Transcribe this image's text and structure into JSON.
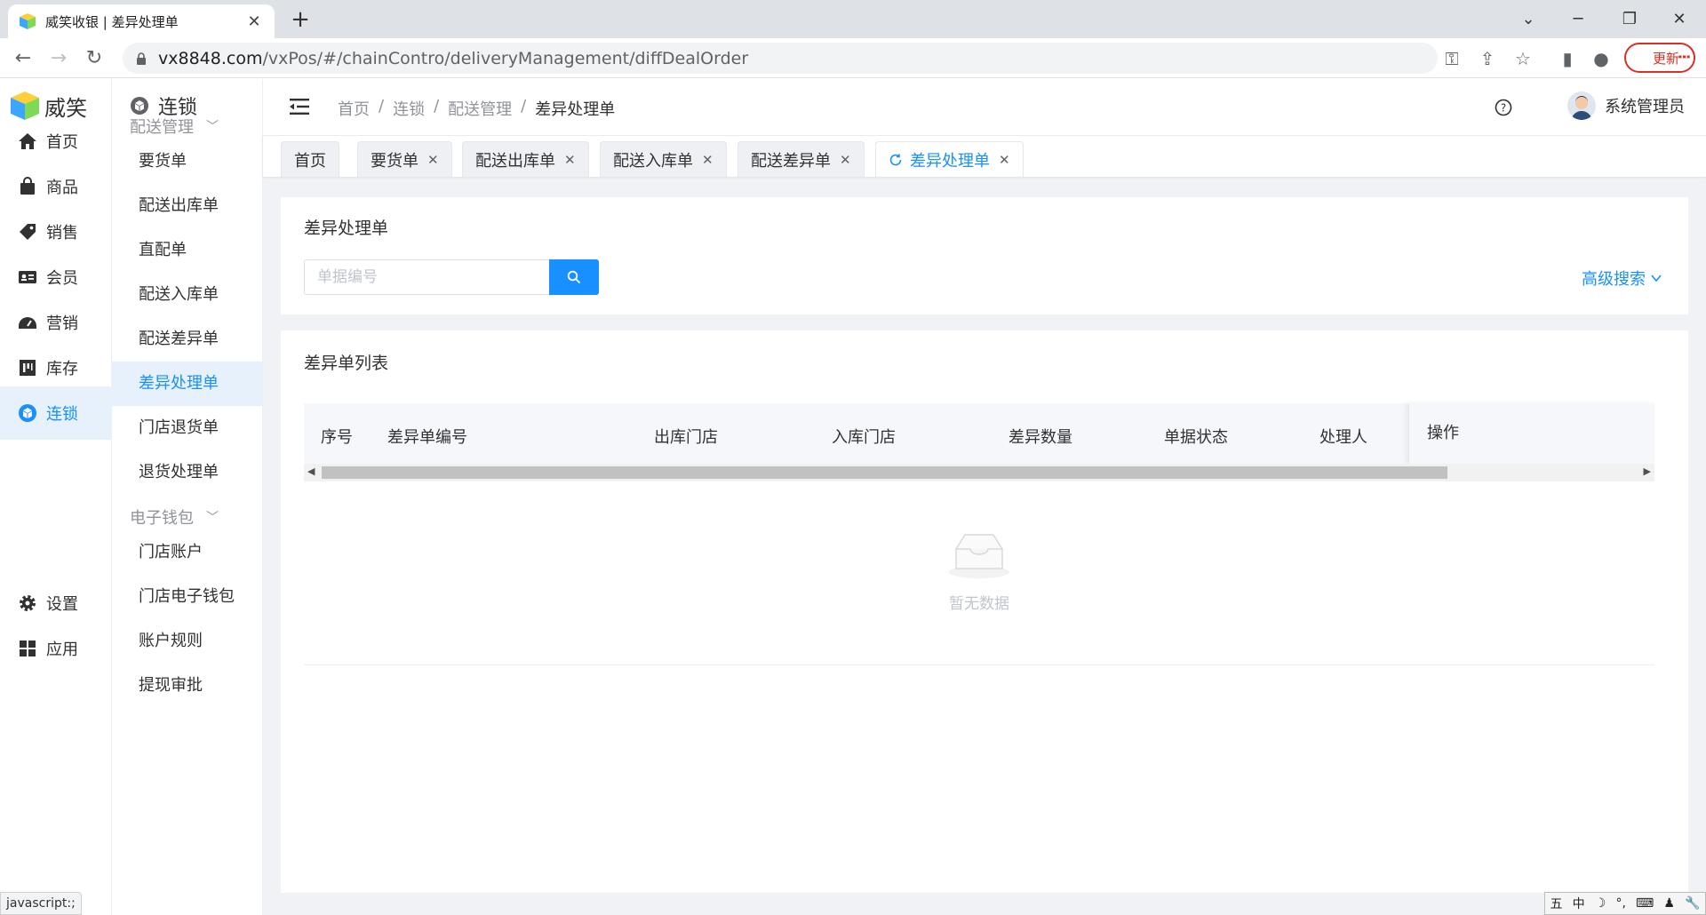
{
  "browser": {
    "tab_title": "威笑收银 | 差异处理单",
    "url_host": "vx8848.com",
    "url_path": "/vxPos/#/chainContro/deliveryManagement/diffDealOrder",
    "update_label": "更新"
  },
  "rail": {
    "brand": "威笑",
    "items": [
      {
        "label": "首页",
        "icon": "home-icon"
      },
      {
        "label": "商品",
        "icon": "bag-icon"
      },
      {
        "label": "销售",
        "icon": "tag-icon"
      },
      {
        "label": "会员",
        "icon": "member-card-icon"
      },
      {
        "label": "营销",
        "icon": "dashboard-icon"
      },
      {
        "label": "库存",
        "icon": "inventory-icon"
      },
      {
        "label": "连锁",
        "icon": "chain-icon"
      }
    ],
    "bottom": [
      {
        "label": "设置",
        "icon": "gear-icon"
      },
      {
        "label": "应用",
        "icon": "apps-icon"
      }
    ],
    "active": "连锁"
  },
  "submenu": {
    "title": "连锁",
    "groups": [
      {
        "label": "配送管理",
        "items": [
          "要货单",
          "配送出库单",
          "直配单",
          "配送入库单",
          "配送差异单",
          "差异处理单",
          "门店退货单",
          "退货处理单"
        ]
      },
      {
        "label": "电子钱包",
        "items": [
          "门店账户",
          "门店电子钱包",
          "账户规则",
          "提现审批"
        ]
      }
    ],
    "active": "差异处理单"
  },
  "topbar": {
    "breadcrumb": [
      "首页",
      "连锁",
      "配送管理",
      "差异处理单"
    ],
    "separator": "/",
    "user": "系统管理员"
  },
  "tags": [
    {
      "label": "首页",
      "closable": false
    },
    {
      "label": "要货单",
      "closable": true
    },
    {
      "label": "配送出库单",
      "closable": true
    },
    {
      "label": "配送入库单",
      "closable": true
    },
    {
      "label": "配送差异单",
      "closable": true
    },
    {
      "label": "差异处理单",
      "closable": true,
      "active": true
    }
  ],
  "search_card": {
    "title": "差异处理单",
    "placeholder": "单据编号",
    "advanced": "高级搜索"
  },
  "list_card": {
    "title": "差异单列表",
    "columns": [
      "序号",
      "差异单编号",
      "出库门店",
      "入库门店",
      "差异数量",
      "单据状态",
      "处理人",
      "操作"
    ],
    "rows": [],
    "empty_text": "暂无数据"
  },
  "statusbar": "javascript:;",
  "ime": [
    "五",
    "中",
    "☽",
    "°,",
    "⌨",
    "♟",
    "🔧"
  ],
  "colors": {
    "accent": "#1890ff",
    "active_bg": "#e6f1fc",
    "update": "#d93025"
  }
}
